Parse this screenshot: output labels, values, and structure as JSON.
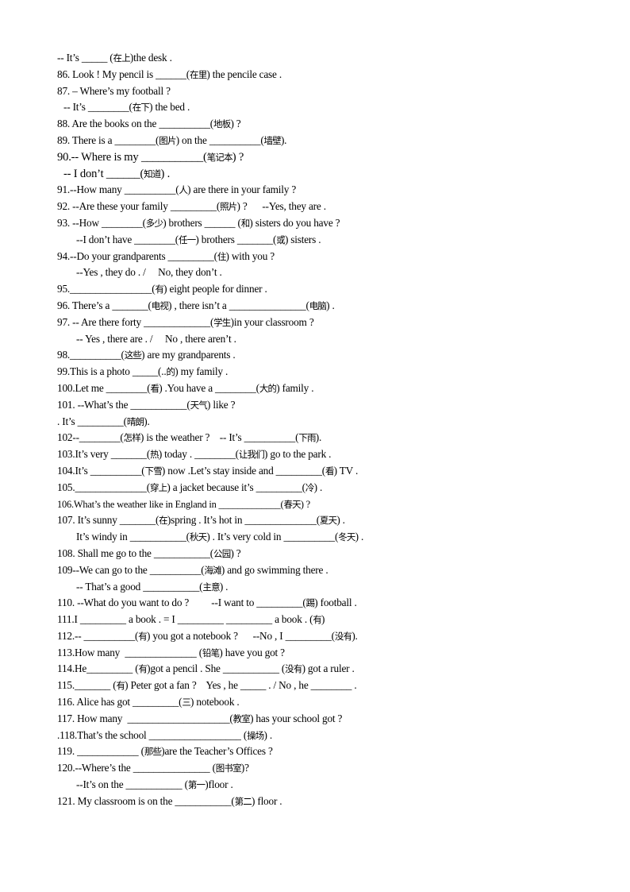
{
  "document": {
    "lines": [
      {
        "id": "85b",
        "indent": 0,
        "text": "-- It’s _____ (在上)the desk ."
      },
      {
        "id": "86",
        "indent": 0,
        "text": "86. Look ! My pencil is ______(在里) the pencile case ."
      },
      {
        "id": "87",
        "indent": 0,
        "text": "87. – Where’s my football ?"
      },
      {
        "id": "87b",
        "indent": 1,
        "text": "-- It’s ________(在下) the bed ."
      },
      {
        "id": "88",
        "indent": 0,
        "text": "88. Are the books on the __________(地板) ?"
      },
      {
        "id": "89",
        "indent": 0,
        "text": "89. There is a ________(图片) on the __________(墙壁)."
      },
      {
        "id": "90",
        "indent": 0,
        "size": "big",
        "text": "90.-- Where is my ___________(笔记本) ?"
      },
      {
        "id": "90b",
        "indent": 1,
        "size": "big",
        "text": "-- I don’t ______(知道) ."
      },
      {
        "id": "91",
        "indent": 0,
        "text": "91.--How many __________(人) are there in your family ?"
      },
      {
        "id": "92",
        "indent": 0,
        "text": "92. --Are these your family _________(照片) ?      --Yes, they are ."
      },
      {
        "id": "93",
        "indent": 0,
        "text": "93. --How ________(多少) brothers ______ (和) sisters do you have ?"
      },
      {
        "id": "93b",
        "indent": 2,
        "text": "--I don’t have ________(任一) brothers _______(或) sisters ."
      },
      {
        "id": "94",
        "indent": 0,
        "text": "94.--Do your grandparents _________(住) with you ?"
      },
      {
        "id": "94b",
        "indent": 2,
        "text": "--Yes , they do . /     No, they don’t ."
      },
      {
        "id": "95",
        "indent": 0,
        "text": "95.________________(有) eight people for dinner ."
      },
      {
        "id": "96",
        "indent": 0,
        "text": "96. There’s a _______(电视) , there isn’t a _______________(电脑) ."
      },
      {
        "id": "97",
        "indent": 0,
        "text": "97. -- Are there forty _____________(学生)in your classroom ?"
      },
      {
        "id": "97b",
        "indent": 2,
        "text": "-- Yes , there are . /     No , there aren’t ."
      },
      {
        "id": "98",
        "indent": 0,
        "text": "98.__________(这些) are my grandparents ."
      },
      {
        "id": "99",
        "indent": 0,
        "text": "99.This is a photo _____(..的) my family ."
      },
      {
        "id": "100",
        "indent": 0,
        "text": "100.Let me ________(看) .You have a ________(大的) family ."
      },
      {
        "id": "101",
        "indent": 0,
        "text": "101. --What’s the ___________(天气) like ?"
      },
      {
        "id": "101b",
        "indent": 0,
        "text": ". It’s _________(晴朗)."
      },
      {
        "id": "102",
        "indent": 0,
        "text": "102--________(怎样) is the weather ?    -- It’s __________(下雨)."
      },
      {
        "id": "103",
        "indent": 0,
        "text": "103.It’s very _______(热) today . ________(让我们) go to the park ."
      },
      {
        "id": "104",
        "indent": 0,
        "text": "104.It’s __________(下雪) now .Let’s stay inside and _________(看) TV ."
      },
      {
        "id": "105",
        "indent": 0,
        "text": "105.______________(穿上) a jacket because it’s _________(冷) ."
      },
      {
        "id": "106",
        "indent": 0,
        "size": "small",
        "text": "106.What’s the weather like in England in _____________(春天) ?"
      },
      {
        "id": "107",
        "indent": 0,
        "text": "107. It’s sunny _______(在)spring . It’s hot in ______________(夏天) ."
      },
      {
        "id": "107b",
        "indent": 2,
        "text": "It’s windy in ___________(秋天) . It’s very cold in __________(冬天) ."
      },
      {
        "id": "108",
        "indent": 0,
        "text": "108. Shall me go to the ___________(公园) ?"
      },
      {
        "id": "109",
        "indent": 0,
        "text": "109--We can go to the __________(海滩) and go swimming there ."
      },
      {
        "id": "109b",
        "indent": 2,
        "text": "-- That’s a good ___________(主意) ."
      },
      {
        "id": "110",
        "indent": 0,
        "text": "110. --What do you want to do ?         --I want to _________(踢) football ."
      },
      {
        "id": "111",
        "indent": 0,
        "text": "111.I _________ a book . = I _________ _________ a book . (有)"
      },
      {
        "id": "112",
        "indent": 0,
        "text": "112.-- __________(有) you got a notebook ?      --No , I _________(没有)."
      },
      {
        "id": "113",
        "indent": 0,
        "text": "113.How many  ______________ (铅笔) have you got ?"
      },
      {
        "id": "114",
        "indent": 0,
        "text": "114.He_________ (有)got a pencil . She ___________ (没有) got a ruler ."
      },
      {
        "id": "115",
        "indent": 0,
        "text": "115._______ (有) Peter got a fan ?    Yes , he _____ . / No , he ________ ."
      },
      {
        "id": "116",
        "indent": 0,
        "text": "116. Alice has got _________(三) notebook ."
      },
      {
        "id": "117",
        "indent": 0,
        "text": "117. How many  ____________________(教室) has your school got ?"
      },
      {
        "id": "118",
        "indent": 0,
        "text": ".118.That’s the school __________________ (操场) ."
      },
      {
        "id": "119",
        "indent": 0,
        "text": "119. ____________ (那些)are the Teacher’s Offices ?"
      },
      {
        "id": "120",
        "indent": 0,
        "text": "120.--Where’s the _______________ (图书室)?"
      },
      {
        "id": "120b",
        "indent": 2,
        "text": "--It’s on the ___________ (第一)floor ."
      },
      {
        "id": "121",
        "indent": 0,
        "text": "121. My classroom is on the ___________(第二) floor ."
      }
    ]
  }
}
